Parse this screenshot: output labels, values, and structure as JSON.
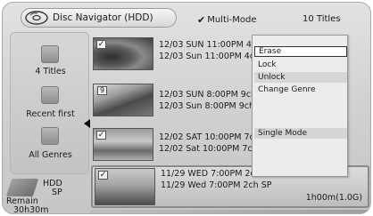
{
  "header": {
    "title": "Disc Navigator (HDD)",
    "multi_mode": "Multi-Mode",
    "title_count": "10 Titles"
  },
  "sidebar": {
    "items": [
      {
        "label": "4 Titles",
        "icon": "list-icon"
      },
      {
        "label": "Recent first",
        "icon": "sort-icon"
      },
      {
        "label": "All Genres",
        "icon": "genre-icon"
      }
    ]
  },
  "storage": {
    "hdd": "HDD",
    "sp": "SP",
    "remain_label": "Remain",
    "remain_value": "30h30m"
  },
  "titles": [
    {
      "checked": true,
      "number": "",
      "line1": "12/03 SUN  11:00PM 4c",
      "line2": "12/03 Sun  11:00PM 4c",
      "duration": ""
    },
    {
      "checked": false,
      "number": "9",
      "line1": "12/03 SUN  8:00PM 9ch",
      "line2": "12/03  Sun  8:00PM 9ch",
      "duration": ""
    },
    {
      "checked": true,
      "number": "",
      "line1": "12/02 SAT 10:00PM 7ch",
      "line2": "12/02 Sat  10:00PM 7ch",
      "duration": ""
    },
    {
      "checked": true,
      "number": "",
      "line1": "11/29 WED 7:00PM 2ch  SP",
      "line2": "11/29 Wed  7:00PM 2ch  SP",
      "duration": "1h00m(1.0G)"
    }
  ],
  "menu": {
    "items": [
      "Erase",
      "Lock",
      "Unlock",
      "Change Genre",
      "Single Mode"
    ]
  }
}
